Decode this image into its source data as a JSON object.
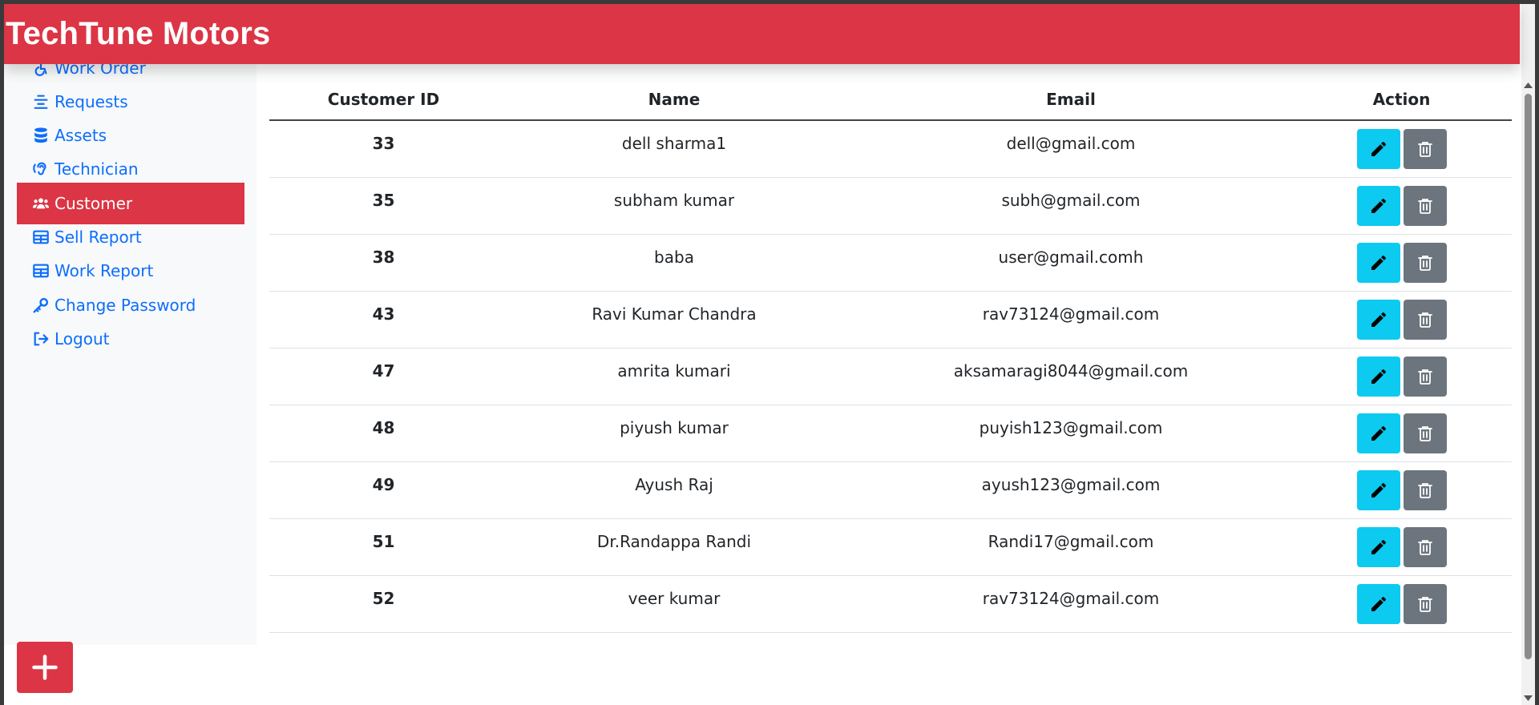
{
  "brand": "TechTune Motors",
  "sidebar": {
    "items": [
      {
        "label": "Work Order",
        "icon": "wheelchair-icon",
        "active": false
      },
      {
        "label": "Requests",
        "icon": "align-center-icon",
        "active": false
      },
      {
        "label": "Assets",
        "icon": "database-icon",
        "active": false
      },
      {
        "label": "Technician",
        "icon": "ear-listen-icon",
        "active": false
      },
      {
        "label": "Customer",
        "icon": "users-icon",
        "active": true
      },
      {
        "label": "Sell Report",
        "icon": "table-icon",
        "active": false
      },
      {
        "label": "Work Report",
        "icon": "table-icon",
        "active": false
      },
      {
        "label": "Change Password",
        "icon": "key-icon",
        "active": false
      },
      {
        "label": "Logout",
        "icon": "sign-out-icon",
        "active": false
      }
    ]
  },
  "table": {
    "headers": {
      "id": "Customer ID",
      "name": "Name",
      "email": "Email",
      "action": "Action"
    },
    "rows": [
      {
        "id": "33",
        "name": "dell sharma1",
        "email": "dell@gmail.com"
      },
      {
        "id": "35",
        "name": "subham kumar",
        "email": "subh@gmail.com"
      },
      {
        "id": "38",
        "name": "baba",
        "email": "user@gmail.comh"
      },
      {
        "id": "43",
        "name": "Ravi Kumar Chandra",
        "email": "rav73124@gmail.com"
      },
      {
        "id": "47",
        "name": "amrita kumari",
        "email": "aksamaragi8044@gmail.com"
      },
      {
        "id": "48",
        "name": "piyush kumar",
        "email": "puyish123@gmail.com"
      },
      {
        "id": "49",
        "name": "Ayush Raj",
        "email": "ayush123@gmail.com"
      },
      {
        "id": "51",
        "name": "Dr.Randappa Randi",
        "email": "Randi17@gmail.com"
      },
      {
        "id": "52",
        "name": "veer kumar",
        "email": "rav73124@gmail.com"
      }
    ]
  },
  "actions": {
    "edit_icon": "pencil-icon",
    "delete_icon": "trash-icon",
    "add_icon": "plus-icon"
  },
  "colors": {
    "brand": "#dc3545",
    "link": "#0d6efd",
    "edit": "#0dcaf0",
    "delete": "#6c757d",
    "sidebar_bg": "#f8f9fa"
  }
}
